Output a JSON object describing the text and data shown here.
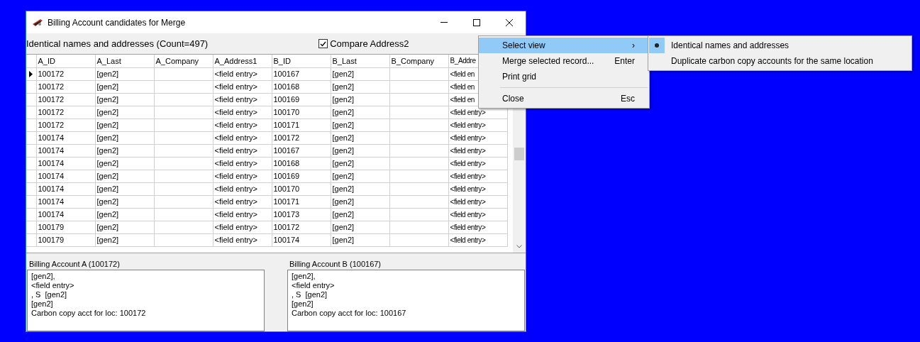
{
  "window": {
    "title": "Billing Account candidates for Merge"
  },
  "view_label": "Identical names and addresses (Count=497)",
  "compare_checkbox": {
    "label": "Compare Address2",
    "checked": true
  },
  "grid": {
    "columns": [
      "A_ID",
      "A_Last",
      "A_Company",
      "A_Address1",
      "B_ID",
      "B_Last",
      "B_Company",
      "B_Addre"
    ],
    "rows": [
      {
        "selected": true,
        "cells": [
          "100172",
          "[gen2]",
          "",
          "<field entry>",
          "100167",
          "[gen2]",
          "",
          "<field en"
        ]
      },
      {
        "selected": false,
        "cells": [
          "100172",
          "[gen2]",
          "",
          "<field entry>",
          "100168",
          "[gen2]",
          "",
          "<field en"
        ]
      },
      {
        "selected": false,
        "cells": [
          "100172",
          "[gen2]",
          "",
          "<field entry>",
          "100169",
          "[gen2]",
          "",
          "<field en"
        ]
      },
      {
        "selected": false,
        "cells": [
          "100172",
          "[gen2]",
          "",
          "<field entry>",
          "100170",
          "[gen2]",
          "",
          "<field entry>"
        ]
      },
      {
        "selected": false,
        "cells": [
          "100172",
          "[gen2]",
          "",
          "<field entry>",
          "100171",
          "[gen2]",
          "",
          "<field entry>"
        ]
      },
      {
        "selected": false,
        "cells": [
          "100174",
          "[gen2]",
          "",
          "<field entry>",
          "100172",
          "[gen2]",
          "",
          "<field entry>"
        ]
      },
      {
        "selected": false,
        "cells": [
          "100174",
          "[gen2]",
          "",
          "<field entry>",
          "100167",
          "[gen2]",
          "",
          "<field entry>"
        ]
      },
      {
        "selected": false,
        "cells": [
          "100174",
          "[gen2]",
          "",
          "<field entry>",
          "100168",
          "[gen2]",
          "",
          "<field entry>"
        ]
      },
      {
        "selected": false,
        "cells": [
          "100174",
          "[gen2]",
          "",
          "<field entry>",
          "100169",
          "[gen2]",
          "",
          "<field entry>"
        ]
      },
      {
        "selected": false,
        "cells": [
          "100174",
          "[gen2]",
          "",
          "<field entry>",
          "100170",
          "[gen2]",
          "",
          "<field entry>"
        ]
      },
      {
        "selected": false,
        "cells": [
          "100174",
          "[gen2]",
          "",
          "<field entry>",
          "100171",
          "[gen2]",
          "",
          "<field entry>"
        ]
      },
      {
        "selected": false,
        "cells": [
          "100174",
          "[gen2]",
          "",
          "<field entry>",
          "100173",
          "[gen2]",
          "",
          "<field entry>"
        ]
      },
      {
        "selected": false,
        "cells": [
          "100179",
          "[gen2]",
          "",
          "<field entry>",
          "100172",
          "[gen2]",
          "",
          "<field entry>"
        ]
      },
      {
        "selected": false,
        "cells": [
          "100179",
          "[gen2]",
          "",
          "<field entry>",
          "100174",
          "[gen2]",
          "",
          "<field entry>"
        ]
      }
    ]
  },
  "accounts": [
    {
      "label": "Billing Account A (100172)",
      "lines": [
        "[gen2],",
        "<field entry>",
        ", S  [gen2]",
        "[gen2]",
        "Carbon copy acct for loc: 100172"
      ]
    },
    {
      "label": "Billing Account B (100167)",
      "lines": [
        "[gen2],",
        "<field entry>",
        ", S  [gen2]",
        "[gen2]",
        "Carbon copy acct for loc: 100167"
      ]
    }
  ],
  "context_menu": {
    "items": [
      {
        "kind": "submenu",
        "label": "Select view",
        "shortcut": "›",
        "highlighted": true
      },
      {
        "kind": "item",
        "label": "Merge selected record...",
        "shortcut": "Enter",
        "highlighted": false
      },
      {
        "kind": "item",
        "label": "Print grid",
        "highlighted": false
      },
      {
        "kind": "separator"
      },
      {
        "kind": "item",
        "label": "Close",
        "shortcut": "Esc",
        "highlighted": false
      }
    ]
  },
  "submenu": {
    "items": [
      {
        "label": "Identical names and addresses",
        "selected": true
      },
      {
        "label": "Duplicate carbon copy accounts for the same location",
        "selected": false
      }
    ]
  }
}
